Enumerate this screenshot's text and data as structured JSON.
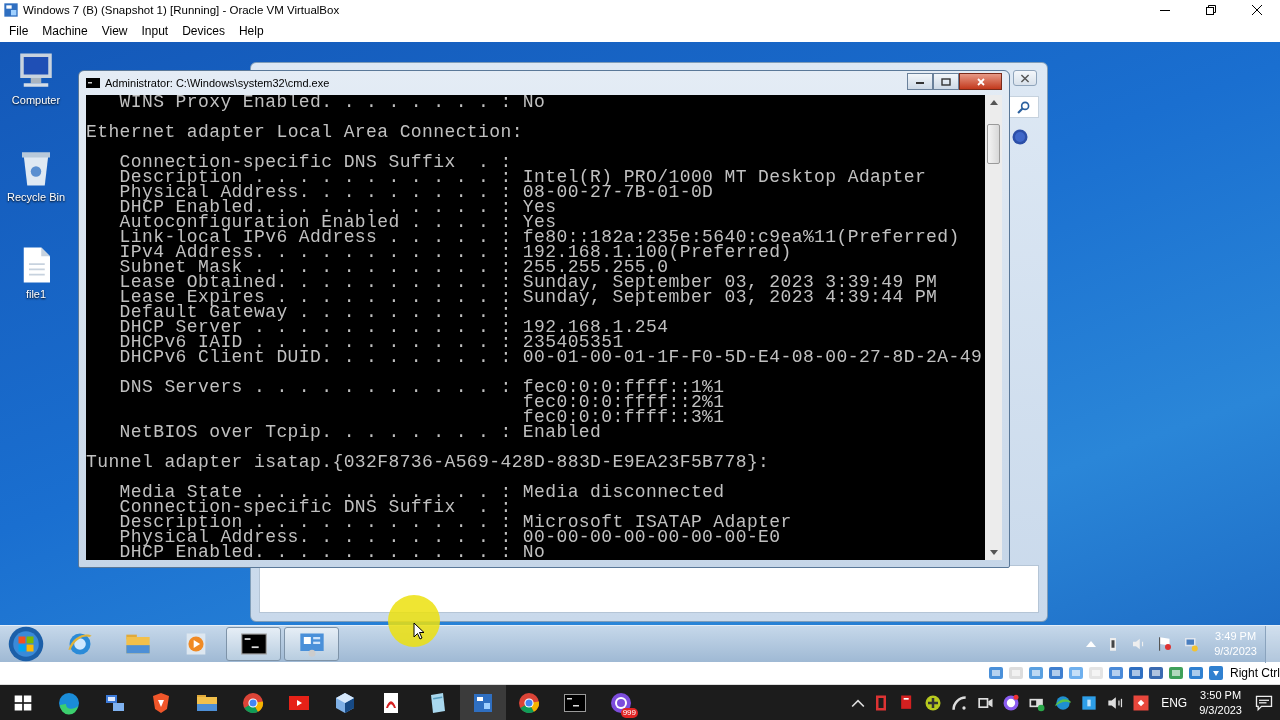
{
  "vm_window": {
    "title": "Windows 7 (B) (Snapshot 1) [Running] - Oracle VM VirtualBox",
    "menu": [
      "File",
      "Machine",
      "View",
      "Input",
      "Devices",
      "Help"
    ]
  },
  "desktop_icons": [
    {
      "label": "Computer",
      "kind": "computer"
    },
    {
      "label": "Recycle Bin",
      "kind": "recycle"
    },
    {
      "label": "file1",
      "kind": "file"
    }
  ],
  "cmd_window": {
    "title": "Administrator: C:\\Windows\\system32\\cmd.exe",
    "blocks": [
      {
        "indented": true,
        "lines": [
          "WINS Proxy Enabled. . . . . . . . : No"
        ]
      },
      {
        "indented": false,
        "lines": [
          "Ethernet adapter Local Area Connection:"
        ]
      },
      {
        "indented": true,
        "lines": [
          "Connection-specific DNS Suffix  . :",
          "Description . . . . . . . . . . . : Intel(R) PRO/1000 MT Desktop Adapter",
          "Physical Address. . . . . . . . . : 08-00-27-7B-01-0D",
          "DHCP Enabled. . . . . . . . . . . : Yes",
          "Autoconfiguration Enabled . . . . : Yes",
          "Link-local IPv6 Address . . . . . : fe80::182a:235e:5640:c9ea%11(Preferred)",
          "IPv4 Address. . . . . . . . . . . : 192.168.1.100(Preferred)",
          "Subnet Mask . . . . . . . . . . . : 255.255.255.0",
          "Lease Obtained. . . . . . . . . . : Sunday, September 03, 2023 3:39:49 PM",
          "Lease Expires . . . . . . . . . . : Sunday, September 03, 2023 4:39:44 PM",
          "Default Gateway . . . . . . . . . :",
          "DHCP Server . . . . . . . . . . . : 192.168.1.254",
          "DHCPv6 IAID . . . . . . . . . . . : 235405351",
          "DHCPv6 Client DUID. . . . . . . . : 00-01-00-01-1F-F0-5D-E4-08-00-27-8D-2A-49"
        ]
      },
      {
        "indented": true,
        "lines": [
          "DNS Servers . . . . . . . . . . . : fec0:0:0:ffff::1%1",
          "                                    fec0:0:0:ffff::2%1",
          "                                    fec0:0:0:ffff::3%1",
          "NetBIOS over Tcpip. . . . . . . . : Enabled"
        ]
      },
      {
        "indented": false,
        "lines": [
          "Tunnel adapter isatap.{032F8736-A569-428D-883D-E9EA23F5B778}:"
        ]
      },
      {
        "indented": true,
        "lines": [
          "Media State . . . . . . . . . . . : Media disconnected",
          "Connection-specific DNS Suffix  . :",
          "Description . . . . . . . . . . . : Microsoft ISATAP Adapter",
          "Physical Address. . . . . . . . . : 00-00-00-00-00-00-00-E0",
          "DHCP Enabled. . . . . . . . . . . : No"
        ]
      }
    ]
  },
  "guest_taskbar": {
    "apps": [
      {
        "kind": "ie",
        "active": false
      },
      {
        "kind": "folder",
        "active": false
      },
      {
        "kind": "media",
        "active": false
      },
      {
        "kind": "cmd",
        "active": true
      },
      {
        "kind": "panel",
        "active": true
      }
    ],
    "clock": {
      "time": "3:49 PM",
      "date": "9/3/2023"
    }
  },
  "status_bar": {
    "host_key": "Right Ctrl"
  },
  "host_taskbar": {
    "apps": [
      {
        "kind": "edge",
        "active": false
      },
      {
        "kind": "network",
        "active": false
      },
      {
        "kind": "brave",
        "active": false
      },
      {
        "kind": "folder",
        "active": false
      },
      {
        "kind": "chrome",
        "active": false
      },
      {
        "kind": "youtube",
        "active": false
      },
      {
        "kind": "cube",
        "active": false
      },
      {
        "kind": "pdf",
        "active": false
      },
      {
        "kind": "notepad",
        "active": false
      },
      {
        "kind": "vbox",
        "active": true
      },
      {
        "kind": "chrome",
        "active": false
      },
      {
        "kind": "cmd",
        "active": false
      },
      {
        "kind": "viber",
        "active": false,
        "badge": "999"
      }
    ],
    "language": "ENG",
    "clock": {
      "time": "3:50 PM",
      "date": "9/3/2023"
    }
  }
}
